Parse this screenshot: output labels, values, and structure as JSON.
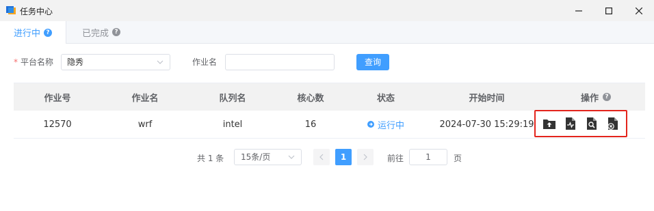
{
  "window": {
    "title": "任务中心"
  },
  "tabs": [
    {
      "label": "进行中",
      "active": true
    },
    {
      "label": "已完成",
      "active": false
    }
  ],
  "filters": {
    "platform_label": "平台名称",
    "platform_value": "隐秀",
    "job_name_label": "作业名",
    "job_name_value": "",
    "query_label": "查询"
  },
  "table": {
    "headers": [
      "作业号",
      "作业名",
      "队列名",
      "核心数",
      "状态",
      "开始时间",
      "操作"
    ],
    "rows": [
      {
        "job_id": "12570",
        "job_name": "wrf",
        "queue": "intel",
        "cores": "16",
        "status": "运行中",
        "start_time": "2024-07-30 15:29:19"
      }
    ],
    "action_icons": [
      "upload-folder-icon",
      "file-monitor-icon",
      "file-search-icon",
      "file-cancel-icon"
    ]
  },
  "pagination": {
    "total_text": "共 1 条",
    "page_size": "15条/页",
    "current_page": "1",
    "goto_label": "前往",
    "goto_value": "1",
    "page_suffix": "页"
  },
  "colors": {
    "primary": "#409eff",
    "highlight_border": "#e3241c",
    "icon_dark": "#333333"
  }
}
